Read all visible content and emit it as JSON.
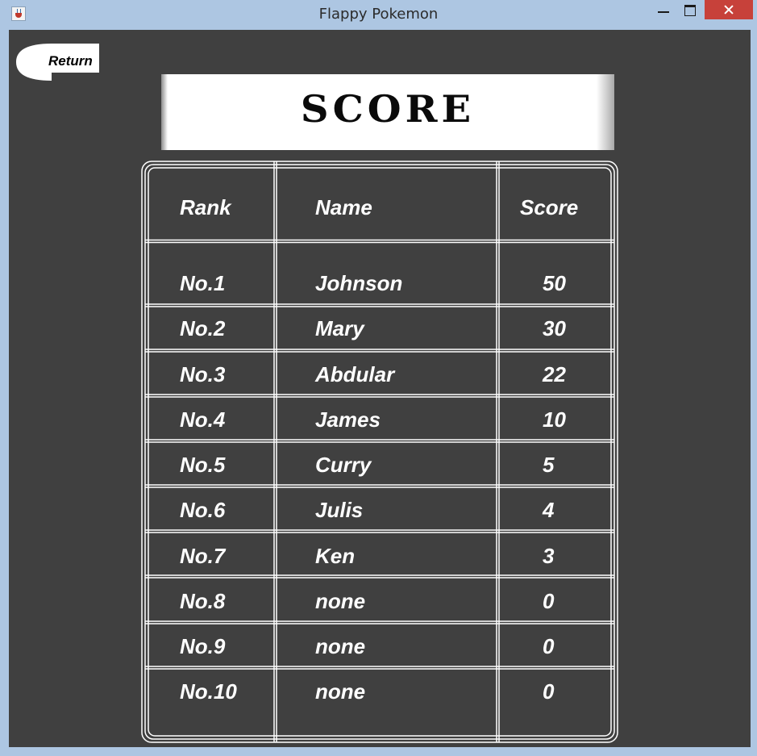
{
  "window": {
    "title": "Flappy Pokemon"
  },
  "return_button": {
    "label": "Return"
  },
  "banner": {
    "title": "SCORE"
  },
  "table": {
    "headers": {
      "rank": "Rank",
      "name": "Name",
      "score": "Score"
    },
    "rows": [
      {
        "rank": "No.1",
        "name": "Johnson",
        "score": "50"
      },
      {
        "rank": "No.2",
        "name": "Mary",
        "score": "30"
      },
      {
        "rank": "No.3",
        "name": "Abdular",
        "score": "22"
      },
      {
        "rank": "No.4",
        "name": "James",
        "score": "10"
      },
      {
        "rank": "No.5",
        "name": "Curry",
        "score": "5"
      },
      {
        "rank": "No.6",
        "name": "Julis",
        "score": "4"
      },
      {
        "rank": "No.7",
        "name": "Ken",
        "score": "3"
      },
      {
        "rank": "No.8",
        "name": "none",
        "score": "0"
      },
      {
        "rank": "No.9",
        "name": "none",
        "score": "0"
      },
      {
        "rank": "No.10",
        "name": "none",
        "score": "0"
      }
    ]
  },
  "colors": {
    "background": "#404040",
    "titlebar": "#adc6e2",
    "close_button": "#c7413a",
    "grid_lines": "#ffffff",
    "text": "#ffffff"
  },
  "icons": {
    "app": "java-cup-icon",
    "minimize": "minimize-icon",
    "maximize": "maximize-icon",
    "close": "close-icon"
  }
}
